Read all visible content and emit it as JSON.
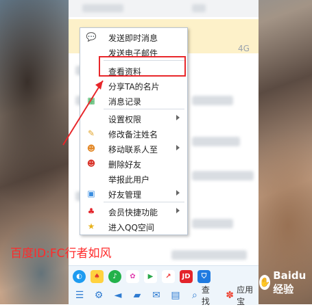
{
  "network_label": "4G",
  "context_menu": {
    "items": [
      {
        "label": "发送即时消息",
        "icon": "chat-bubble-icon",
        "submenu": false
      },
      {
        "label": "发送电子邮件",
        "icon": "",
        "submenu": false
      },
      {
        "label": "查看资料",
        "icon": "",
        "submenu": false,
        "highlighted": true
      },
      {
        "label": "分享TA的名片",
        "icon": "",
        "submenu": false
      },
      {
        "label": "消息记录",
        "icon": "message-log-icon",
        "submenu": false
      },
      {
        "label": "设置权限",
        "icon": "",
        "submenu": true
      },
      {
        "label": "修改备注姓名",
        "icon": "edit-pencil-icon",
        "submenu": false
      },
      {
        "label": "移动联系人至",
        "icon": "move-contact-icon",
        "submenu": true
      },
      {
        "label": "删除好友",
        "icon": "delete-friend-icon",
        "submenu": false
      },
      {
        "label": "举报此用户",
        "icon": "",
        "submenu": false
      },
      {
        "label": "好友管理",
        "icon": "friend-manage-icon",
        "submenu": true
      },
      {
        "label": "会员快捷功能",
        "icon": "qq-penguin-icon",
        "submenu": true
      },
      {
        "label": "进入QQ空间",
        "icon": "qzone-star-icon",
        "submenu": false
      }
    ]
  },
  "annotation_color": "#e8262a",
  "watermark_text": "百度ID:FC行者如风",
  "bottom_toolbar": {
    "search_label": "查找",
    "app_store_label": "应用宝"
  },
  "brand_text": "Baidu 经验"
}
